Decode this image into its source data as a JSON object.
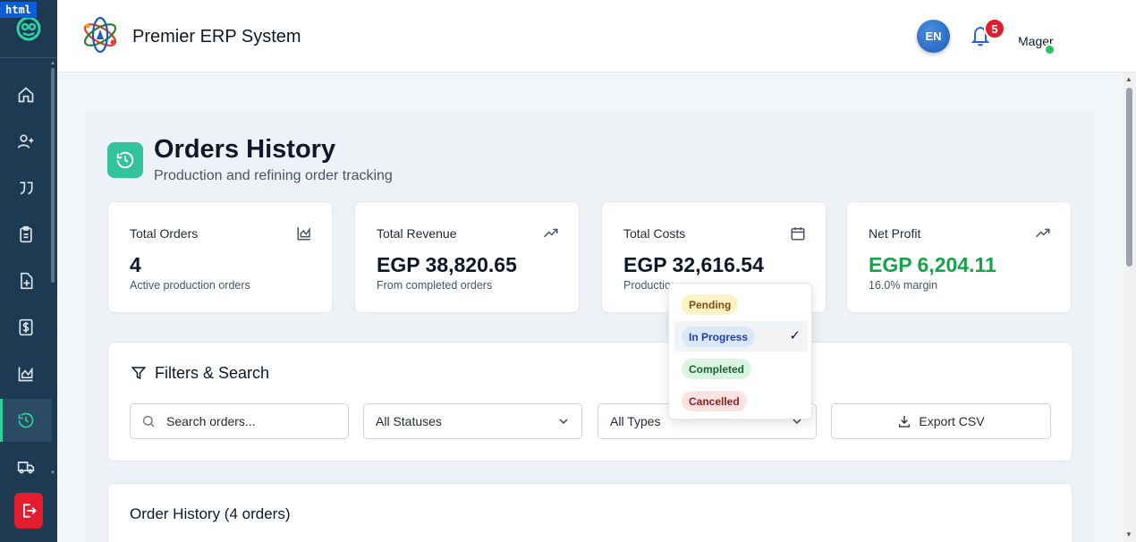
{
  "dev_badge": "html",
  "app": {
    "title": "Premier ERP System"
  },
  "header": {
    "language": "EN",
    "notifications_count": "5",
    "avatar_alt": "Mager"
  },
  "sidebar": {
    "items": [
      {
        "icon": "home-icon"
      },
      {
        "icon": "add-user-icon"
      },
      {
        "icon": "quote-icon"
      },
      {
        "icon": "clipboard-icon"
      },
      {
        "icon": "file-plus-icon"
      },
      {
        "icon": "dollar-icon"
      },
      {
        "icon": "chart-icon"
      },
      {
        "icon": "history-icon",
        "active": true
      },
      {
        "icon": "truck-icon"
      }
    ],
    "logout_icon": "logout-icon"
  },
  "page": {
    "title": "Orders History",
    "subtitle": "Production and refining order tracking"
  },
  "stats": [
    {
      "label": "Total Orders",
      "value": "4",
      "note": "Active production orders",
      "icon": "chart-icon"
    },
    {
      "label": "Total Revenue",
      "value": "EGP 38,820.65",
      "note": "From completed orders",
      "icon": "trending-up-icon"
    },
    {
      "label": "Total Costs",
      "value": "EGP 32,616.54",
      "note": "Production",
      "icon": "calendar-icon"
    },
    {
      "label": "Net Profit",
      "value": "EGP 6,204.11",
      "note": "16.0% margin",
      "icon": "trending-up-icon"
    }
  ],
  "filters": {
    "title": "Filters & Search",
    "search_placeholder": "Search orders...",
    "status_select": "All Statuses",
    "type_select": "All Types",
    "export_label": "Export CSV"
  },
  "status_dropdown": {
    "options": [
      {
        "label": "Pending",
        "bg": "#fdf3c4",
        "fg": "#854d0e"
      },
      {
        "label": "In Progress",
        "bg": "#dbe7fb",
        "fg": "#1e40af",
        "selected": true
      },
      {
        "label": "Completed",
        "bg": "#dcf5e3",
        "fg": "#166534"
      },
      {
        "label": "Cancelled",
        "bg": "#fde2e2",
        "fg": "#991b1b"
      }
    ],
    "check_mark": "✓"
  },
  "history": {
    "title": "Order History (4 orders)"
  },
  "colors": {
    "sidebar": "#1d3a52",
    "accent": "#33c39a",
    "profit": "#16a34a",
    "logout": "#e11d2e"
  }
}
